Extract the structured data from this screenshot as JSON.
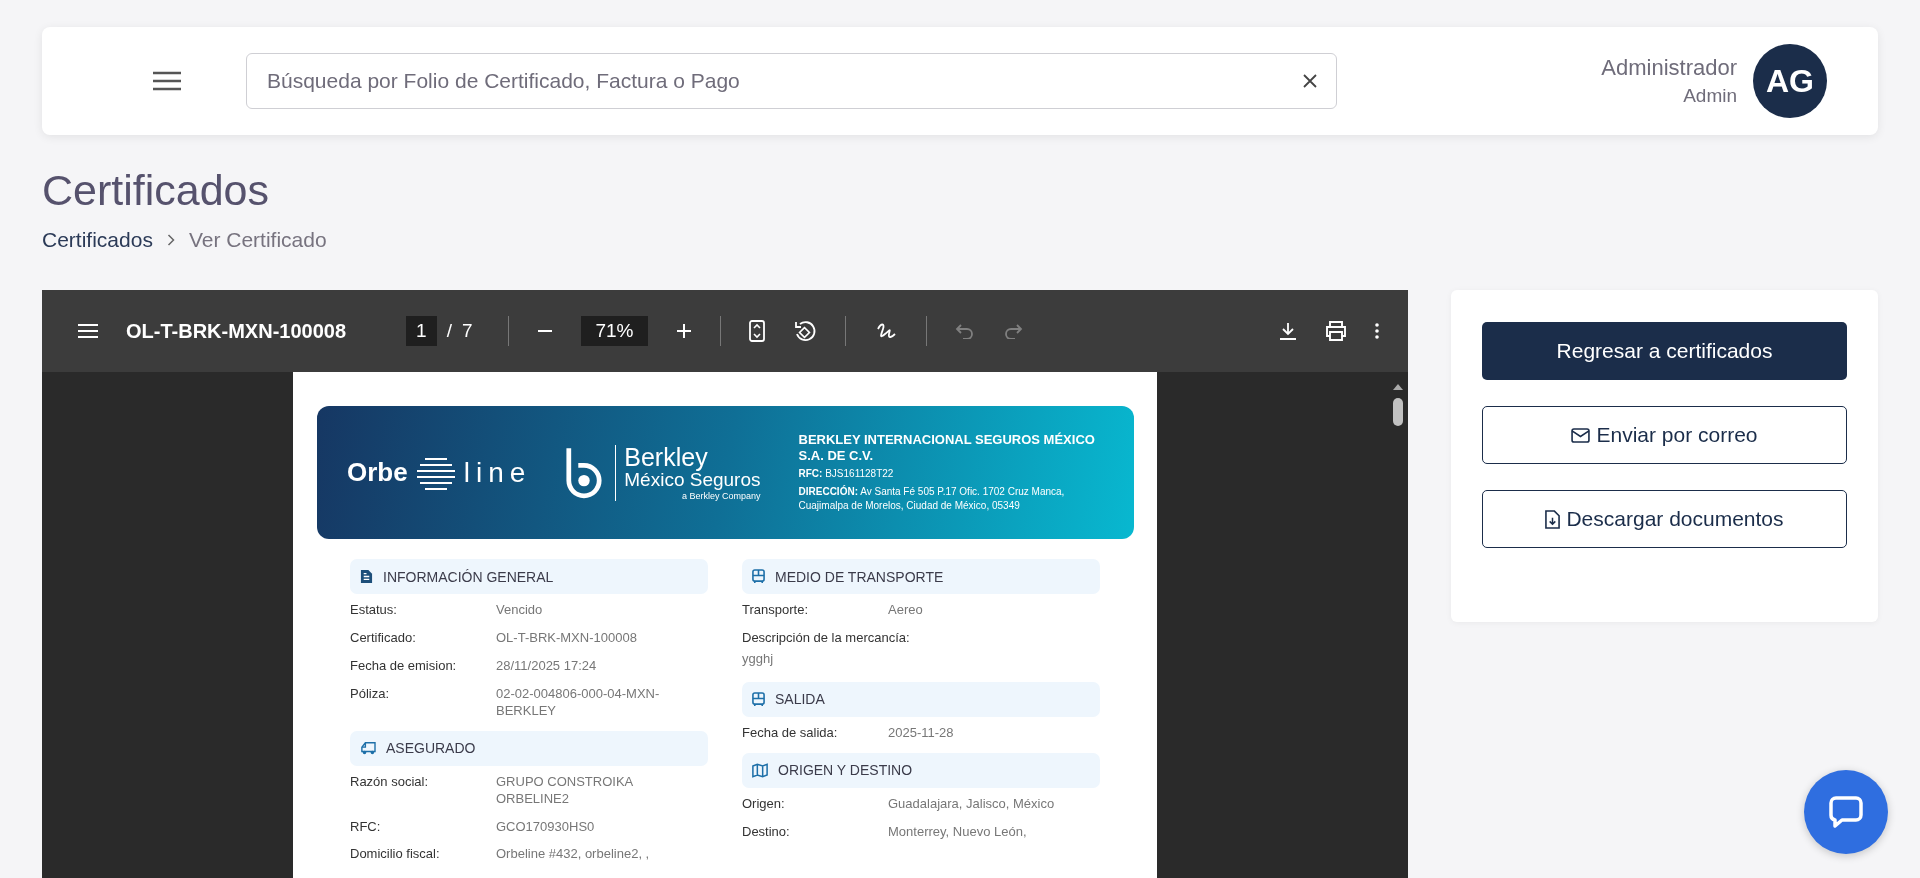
{
  "header": {
    "search": {
      "placeholder": "Búsqueda por Folio de Certificado, Factura o Pago"
    },
    "user": {
      "name": "Administrador",
      "role": "Admin",
      "initials": "AG"
    }
  },
  "page": {
    "title": "Certificados",
    "breadcrumb": [
      {
        "label": "Certificados",
        "selected": false
      },
      {
        "label": "Ver Certificado",
        "selected": true
      }
    ]
  },
  "viewer": {
    "toolbar": {
      "title": "OL-T-BRK-MXN-100008",
      "page_current": "1",
      "page_separator": "/",
      "page_total": "7",
      "zoom": "71%",
      "history": [
        {
          "kind": "undo",
          "disabled": true
        },
        {
          "kind": "redo",
          "disabled": true
        }
      ]
    },
    "document": {
      "banner": {
        "logo_left": "Orbe",
        "logo_right": "line",
        "brand_name": "Berkley",
        "brand_sub": "México Seguros",
        "brand_tag": "a Berkley Company",
        "company": "BERKLEY INTERNACIONAL SEGUROS MÉXICO S.A. DE C.V.",
        "rfc": "**RFC:** BJS161128T22",
        "address": "**DIRECCIÓN:** Av Santa Fé 505 P.17 Ofic. 1702 Cruz Manca, Cuajimalpa de Morelos, Ciudad de México, 05349"
      },
      "columns": [
        [
          {
            "title": "INFORMACIÓN GENERAL",
            "kind": "document",
            "rows": [
              {
                "kind": "pair",
                "label": "Estatus:",
                "value": "Vencido"
              },
              {
                "kind": "pair",
                "label": "Certificado:",
                "value": "OL-T-BRK-MXN-100008"
              },
              {
                "kind": "pair",
                "label": "Fecha de emision:",
                "value": "28/11/2025 17:24"
              },
              {
                "kind": "pair",
                "label": "Póliza:",
                "value": "02-02-004806-000-04-MXN-BERKLEY"
              }
            ]
          },
          {
            "title": "ASEGURADO",
            "kind": "insured",
            "rows": [
              {
                "kind": "pair",
                "label": "Razón social:",
                "value": "GRUPO CONSTROIKA ORBELINE2"
              },
              {
                "kind": "pair",
                "label": "RFC:",
                "value": "GCO170930HS0"
              },
              {
                "kind": "pair",
                "label": "Domicilio fiscal:",
                "value": "Orbeline #432, orbeline2, ,"
              }
            ]
          }
        ],
        [
          {
            "title": "MEDIO DE TRANSPORTE",
            "kind": "transport",
            "rows": [
              {
                "kind": "pair",
                "label": "Transporte:",
                "value": "Aereo"
              },
              {
                "kind": "stacked",
                "label": "Descripción de la mercancía:",
                "value": "ygghj"
              }
            ]
          },
          {
            "title": "SALIDA",
            "kind": "departure",
            "rows": [
              {
                "kind": "pair",
                "label": "Fecha de salida:",
                "value": "2025-11-28"
              }
            ]
          },
          {
            "title": "ORIGEN Y DESTINO",
            "kind": "route",
            "rows": [
              {
                "kind": "pair",
                "label": "Origen:",
                "value": "Guadalajara, Jalisco, México"
              },
              {
                "kind": "pair",
                "label": "Destino:",
                "value": "Monterrey, Nuevo León,"
              }
            ]
          }
        ]
      ]
    }
  },
  "actions": [
    {
      "kind": "primary",
      "label": "Regresar a certificados"
    },
    {
      "kind": "mail",
      "label": "Enviar por correo"
    },
    {
      "kind": "download",
      "label": "Descargar documentos"
    }
  ]
}
